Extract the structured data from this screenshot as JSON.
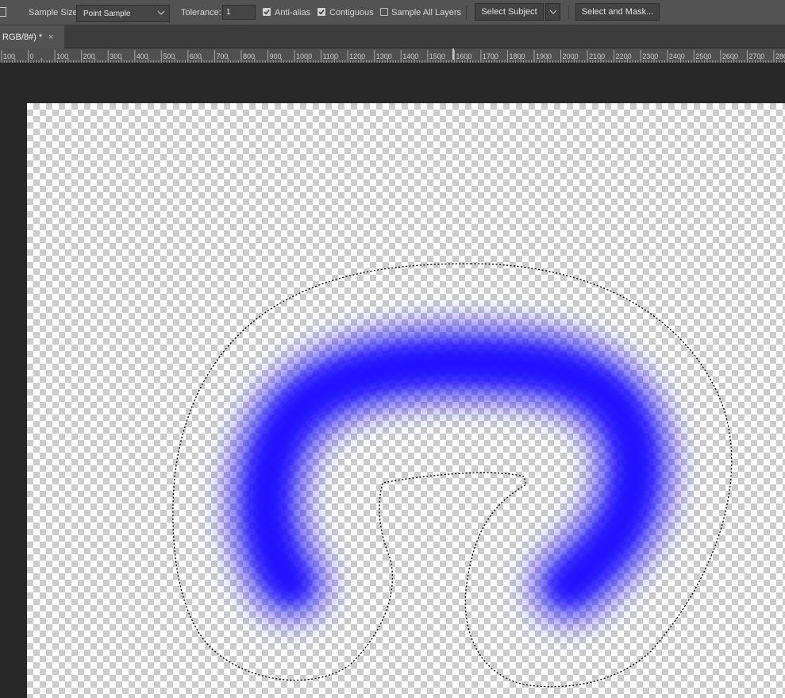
{
  "options_bar": {
    "sample_size_label": "Sample Size:",
    "sample_size_value": "Point Sample",
    "tolerance_label": "Tolerance:",
    "tolerance_value": "1",
    "anti_alias_label": "Anti-alias",
    "anti_alias_checked": true,
    "contiguous_label": "Contiguous",
    "contiguous_checked": true,
    "sample_all_layers_label": "Sample All Layers",
    "sample_all_layers_checked": false,
    "select_subject_label": "Select Subject",
    "select_and_mask_label": "Select and Mask..."
  },
  "document_tab": {
    "title": "RGB/8#) *",
    "close_glyph": "×"
  },
  "ruler": {
    "labels": [
      "100",
      "0",
      "100",
      "200",
      "300",
      "400",
      "500",
      "600",
      "700",
      "800",
      "900",
      "1000",
      "1100",
      "1200",
      "1300",
      "1400",
      "1500",
      "1600",
      "1700",
      "1800",
      "1900",
      "2000",
      "2100",
      "2200",
      "2300",
      "2400",
      "2500",
      "2600",
      "2700",
      "2800"
    ]
  },
  "canvas": {
    "stroke_color": "#1a10ff",
    "background": "transparent-checkerboard"
  }
}
